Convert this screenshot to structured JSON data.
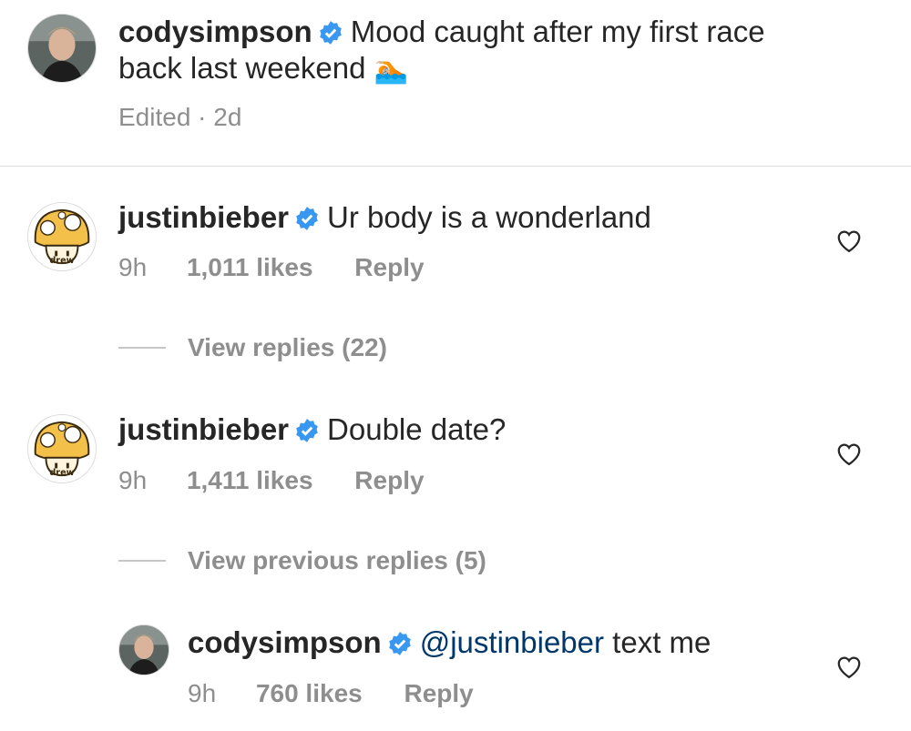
{
  "post": {
    "username": "codysimpson",
    "caption_line1": "Mood caught after my first race",
    "caption_line2": "back last weekend",
    "caption_emoji": "🏊🏼",
    "edited": "Edited · 2d"
  },
  "comments": [
    {
      "username": "justinbieber",
      "text": "Ur body is a wonderland",
      "time": "9h",
      "likes": "1,011 likes",
      "reply_label": "Reply",
      "view_replies": "View replies (22)"
    },
    {
      "username": "justinbieber",
      "text": "Double date?",
      "time": "9h",
      "likes": "1,411 likes",
      "reply_label": "Reply",
      "view_replies": "View previous replies (5)"
    }
  ],
  "reply": {
    "username": "codysimpson",
    "mention": "@justinbieber",
    "text": " text me",
    "time": "9h",
    "likes": "760 likes",
    "reply_label": "Reply"
  },
  "icons": {
    "verified": "verified-badge-icon",
    "heart": "heart-outline-icon",
    "mushroom_avatar_text": "drew"
  },
  "colors": {
    "verified_blue": "#3897f0",
    "mention_blue": "#00376b",
    "secondary_text": "#8e8e8e"
  }
}
